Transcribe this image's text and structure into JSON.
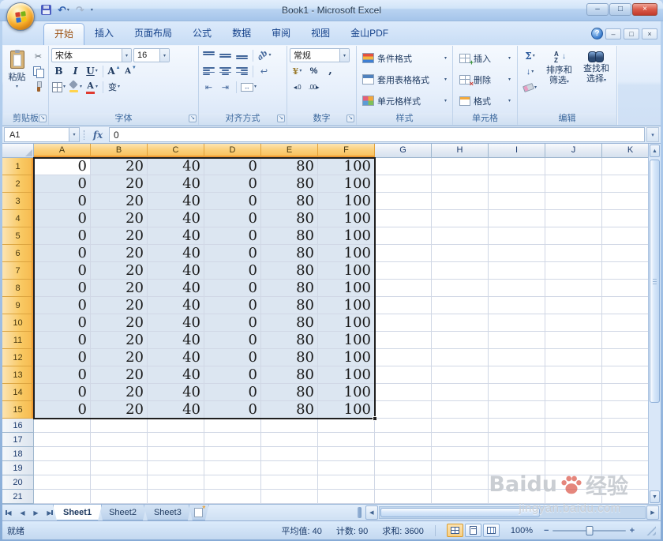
{
  "window": {
    "title": "Book1 - Microsoft Excel"
  },
  "ribbon": {
    "tabs": [
      {
        "label": "开始",
        "active": true
      },
      {
        "label": "插入"
      },
      {
        "label": "页面布局"
      },
      {
        "label": "公式"
      },
      {
        "label": "数据"
      },
      {
        "label": "审阅"
      },
      {
        "label": "视图"
      },
      {
        "label": "金山PDF"
      }
    ],
    "clipboard": {
      "label": "剪贴板",
      "paste": "粘贴"
    },
    "font": {
      "label": "字体",
      "name": "宋体",
      "size": "16"
    },
    "alignment": {
      "label": "对齐方式"
    },
    "number": {
      "label": "数字",
      "format": "常规"
    },
    "styles": {
      "label": "样式",
      "conditional": "条件格式",
      "table": "套用表格格式",
      "cell": "单元格样式"
    },
    "cells": {
      "label": "单元格",
      "insert": "插入",
      "delete": "删除",
      "format": "格式"
    },
    "editing": {
      "label": "编辑",
      "sort": "排序和筛选",
      "find": "查找和选择"
    }
  },
  "formula_bar": {
    "name_box": "A1",
    "value": "0"
  },
  "grid": {
    "columns": [
      "A",
      "B",
      "C",
      "D",
      "E",
      "F",
      "G",
      "H",
      "I",
      "J",
      "K"
    ],
    "selected_columns": 6,
    "row_count": 21,
    "data_row_count": 15,
    "row_values": [
      "0",
      "20",
      "40",
      "0",
      "80",
      "100"
    ]
  },
  "sheet_bar": {
    "tabs": [
      {
        "label": "Sheet1",
        "active": true
      },
      {
        "label": "Sheet2"
      },
      {
        "label": "Sheet3"
      }
    ]
  },
  "status_bar": {
    "mode": "就绪",
    "average": "平均值: 40",
    "count": "计数: 90",
    "sum": "求和: 3600",
    "zoom": "100%"
  },
  "watermark": {
    "brand": "Baidu",
    "suffix": "经验",
    "url": "jingyan.baidu.com"
  },
  "glyphs": {
    "dropdown": "▾",
    "undo": "↶",
    "redo": "↷",
    "win_min": "–",
    "win_max": "□",
    "win_close": "×",
    "help": "?",
    "launcher": "↘",
    "cut": "✂",
    "bold": "B",
    "italic": "I",
    "underline": "U",
    "grow_a": "A",
    "caret_up": "▲",
    "caret_down": "▼",
    "color_a": "A",
    "pinyin": "变",
    "orient": "ab",
    "wrap": "↩",
    "indent_dec": "⇤",
    "indent_inc": "⇥",
    "merge": "↔",
    "currency": "¥",
    "percent": "%",
    "comma": ",",
    "inc_dec": "◂.0",
    "dec_dec": ".00▸",
    "fx": "fx",
    "sum": "Σ",
    "fill": "↓",
    "sort_a": "A",
    "sort_z": "Z",
    "arrow_down": "↓",
    "left": "◀",
    "right": "▶",
    "up": "▲",
    "down": "▼",
    "minus": "−",
    "plus": "+",
    "star": "*"
  }
}
